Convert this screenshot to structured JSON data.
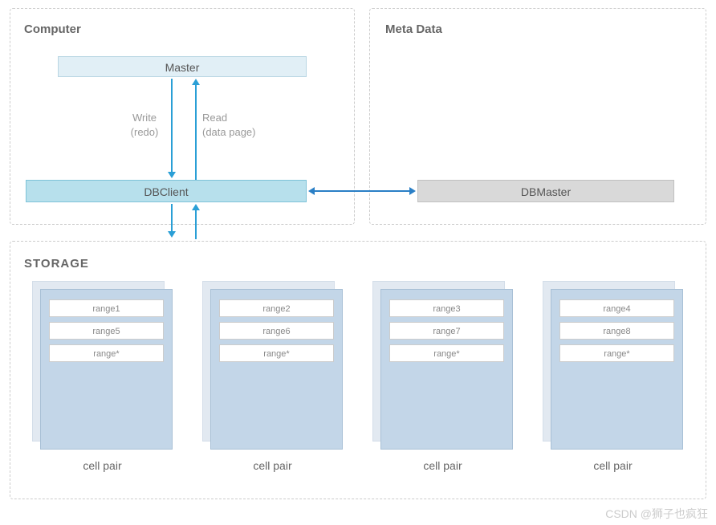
{
  "computer": {
    "title": "Computer",
    "master_label": "Master",
    "dbclient_label": "DBClient",
    "write_label_line1": "Write",
    "write_label_line2": "(redo)",
    "read_label_line1": "Read",
    "read_label_line2": "(data page)"
  },
  "meta": {
    "title": "Meta Data",
    "dbmaster_label": "DBMaster"
  },
  "storage": {
    "title": "STORAGE",
    "cell_label": "cell pair",
    "cells": [
      {
        "ranges": [
          "range1",
          "range5",
          "range*"
        ]
      },
      {
        "ranges": [
          "range2",
          "range6",
          "range*"
        ]
      },
      {
        "ranges": [
          "range3",
          "range7",
          "range*"
        ]
      },
      {
        "ranges": [
          "range4",
          "range8",
          "range*"
        ]
      }
    ]
  },
  "watermark": "CSDN @狮子也疯狂"
}
